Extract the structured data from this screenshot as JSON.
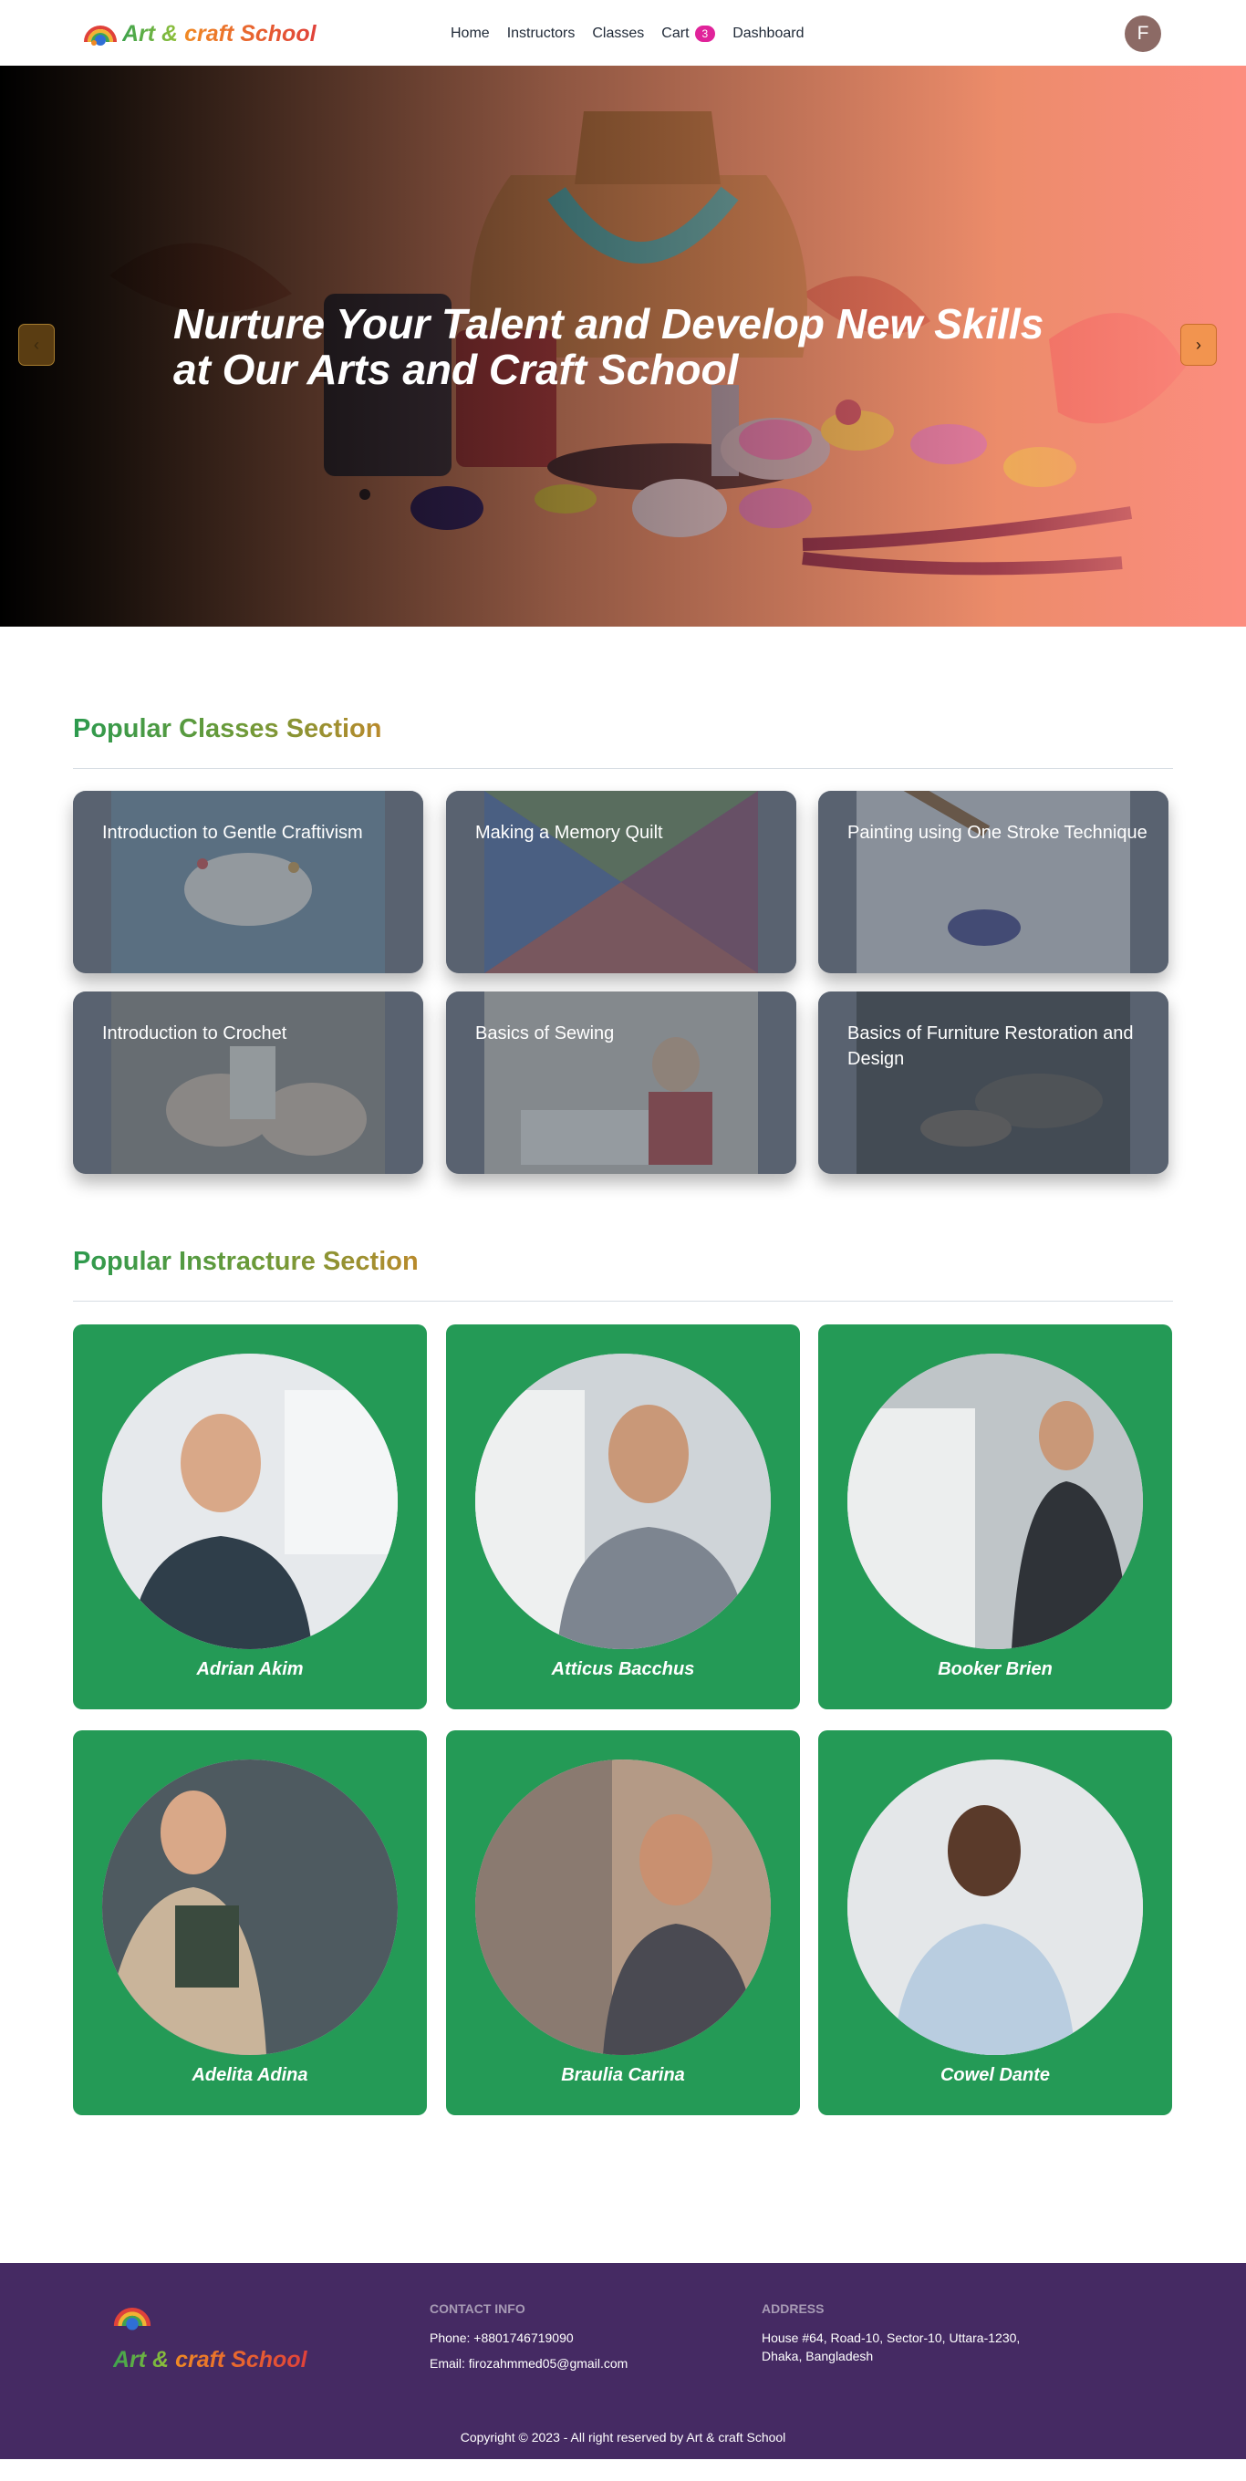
{
  "nav": {
    "brand_part1": "Art &",
    "brand_part2": "craft School",
    "links": [
      "Home",
      "Instructors",
      "Classes",
      "Cart",
      "Dashboard"
    ],
    "cart_count": "3",
    "avatar_initial": "F"
  },
  "hero": {
    "title_line1": "Nurture Your Talent and Develop New Skills",
    "title_line2": "at Our Arts and Craft School",
    "prev_label": "‹",
    "next_label": "›"
  },
  "classes": {
    "title": "Popular Classes Section",
    "items": [
      "Introduction to Gentle Craftivism",
      "Making a Memory Quilt",
      "Painting using One Stroke Technique",
      "Introduction to Crochet",
      "Basics of Sewing",
      "Basics of Furniture Restoration and Design"
    ]
  },
  "instructors": {
    "title": "Popular Instracture Section",
    "items": [
      "Adrian Akim",
      "Atticus Bacchus",
      "Booker Brien",
      "Adelita Adina",
      "Braulia Carina",
      "Cowel Dante"
    ]
  },
  "footer": {
    "brand_part1": "Art &",
    "brand_part2": "craft School",
    "contact_heading": "CONTACT INFO",
    "phone": "Phone: +8801746719090",
    "email": "Email: firozahmmed05@gmail.com",
    "address_heading": "ADDRESS",
    "address_line1": "House #64, Road-10, Sector-10, Uttara-1230,",
    "address_line2": "Dhaka, Bangladesh",
    "copyright": "Copyright © 2023 - All right reserved by Art & craft School"
  },
  "colors": {
    "primary_green": "#249a56",
    "footer_purple": "#452a63",
    "cart_badge": "#e0239a",
    "carousel_next": "#f2944f"
  }
}
